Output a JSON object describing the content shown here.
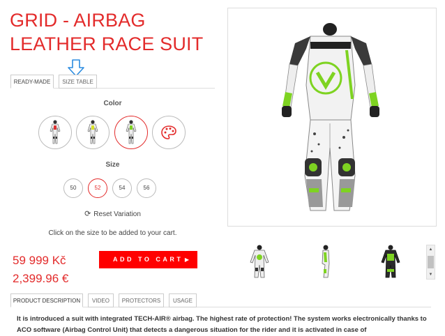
{
  "product": {
    "title": "GRID - AIRBAG LEATHER RACE SUIT"
  },
  "variation_tabs": [
    {
      "label": "READY-MADE",
      "active": true
    },
    {
      "label": "SIZE TABLE",
      "active": false
    }
  ],
  "color": {
    "label": "Color",
    "options": [
      {
        "name": "suit-red-white",
        "selected": false
      },
      {
        "name": "suit-yellow-white",
        "selected": false
      },
      {
        "name": "suit-green-white",
        "selected": true
      },
      {
        "name": "custom-palette",
        "selected": false
      }
    ]
  },
  "size": {
    "label": "Size",
    "options": [
      {
        "label": "50",
        "selected": false
      },
      {
        "label": "52",
        "selected": true
      },
      {
        "label": "54",
        "selected": false
      },
      {
        "label": "56",
        "selected": false
      }
    ]
  },
  "reset_label": "Reset Variation",
  "hint": "Click on the size to be added to your cart.",
  "price": {
    "czk": "59 999 Kč",
    "eur": "2,399.96 €"
  },
  "cart_button": {
    "label": "ADD TO CART",
    "icon": "chevron-right-icon"
  },
  "thumbnails": [
    {
      "name": "suit-front-thumbnail"
    },
    {
      "name": "suit-side-thumbnail"
    },
    {
      "name": "suit-back-thumbnail"
    }
  ],
  "detail_tabs": [
    {
      "label": "PRODUCT DESCRIPTION",
      "active": true
    },
    {
      "label": "VIDEO",
      "active": false
    },
    {
      "label": "PROTECTORS",
      "active": false
    },
    {
      "label": "USAGE",
      "active": false
    }
  ],
  "description": "It is introduced a suit with integrated TECH-AIR® airbag. The highest rate of protection! The system works electronically thanks to ACO software (Airbag Control Unit) that detects a dangerous situation for the rider and it is activated in case of",
  "colors": {
    "accent": "#e32b2b",
    "cart_button": "#ff0000",
    "suit_green": "#7ed321"
  }
}
